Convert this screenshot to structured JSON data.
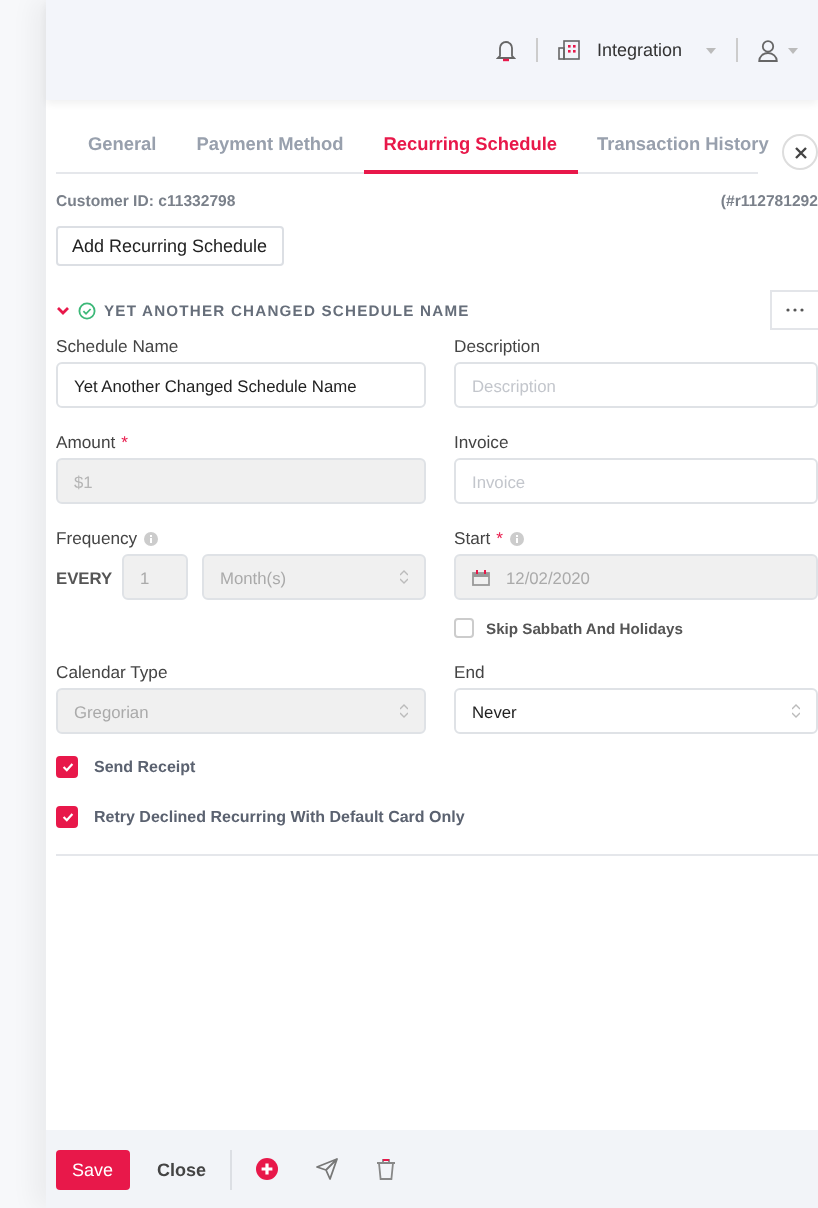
{
  "header": {
    "company": "Integration"
  },
  "tabs": [
    {
      "label": "General",
      "selected": false
    },
    {
      "label": "Payment Method",
      "selected": false
    },
    {
      "label": "Recurring Schedule",
      "selected": true
    },
    {
      "label": "Transaction History",
      "selected": false
    }
  ],
  "customer_id": "Customer ID: c11332798",
  "reference": "(#r112781292",
  "add_button": "Add Recurring Schedule",
  "schedule": {
    "title": "YET ANOTHER CHANGED SCHEDULE NAME",
    "expanded": true,
    "complete": true
  },
  "fields": [
    {
      "kind": "text",
      "label": "Schedule Name",
      "value": "Yet Another Changed Schedule Name",
      "disabled": false
    },
    {
      "kind": "text",
      "label": "Description",
      "placeholder": "Description",
      "disabled": false
    },
    {
      "kind": "text",
      "label": "Amount",
      "required_mark": "*",
      "placeholder": "$1",
      "disabled": true
    },
    {
      "kind": "text",
      "label": "Invoice",
      "placeholder": "Invoice",
      "disabled": false
    },
    {
      "kind": "frequency",
      "label": "Frequency",
      "info": true,
      "prefix": "EVERY",
      "count": "1",
      "unit": "Month(s)",
      "disabled": true
    },
    {
      "kind": "date",
      "label": "Start",
      "required_mark": "*",
      "info": true,
      "value": "12/02/2020",
      "disabled": true,
      "option": {
        "label": "Skip Sabbath And Holidays",
        "checked": false
      }
    },
    {
      "kind": "select",
      "label": "Calendar Type",
      "value": "Gregorian",
      "disabled": true
    },
    {
      "kind": "select",
      "label": "End",
      "value": "Never",
      "disabled": false
    }
  ],
  "checkboxes": [
    {
      "label": "Send Receipt",
      "checked": true
    },
    {
      "label": "Retry Declined Recurring With Default Card Only",
      "checked": true
    }
  ],
  "footer": {
    "save": "Save",
    "close": "Close"
  }
}
